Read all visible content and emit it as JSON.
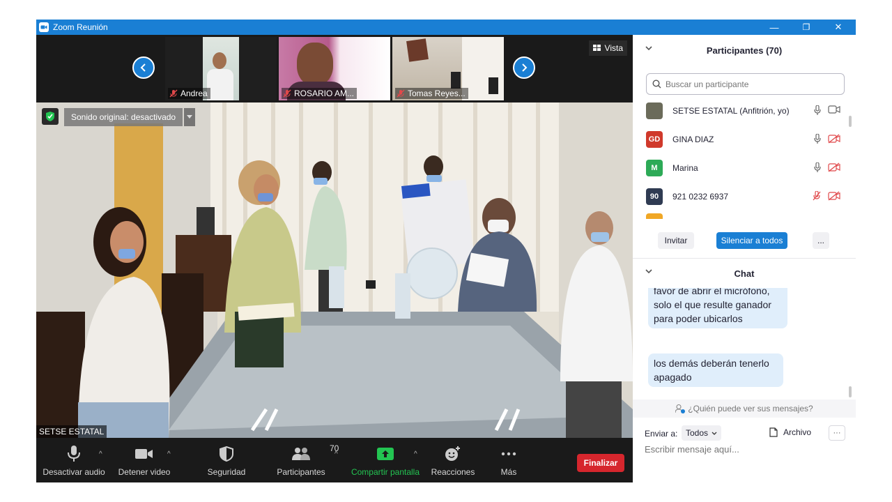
{
  "window": {
    "title": "Zoom Reunión",
    "controls": {
      "minimize": "—",
      "restore": "❐",
      "close": "✕"
    }
  },
  "video": {
    "view_label": "Vista",
    "thumbnails": [
      {
        "name": "Andrea",
        "muted": true
      },
      {
        "name": "ROSARIO AM...",
        "muted": true
      },
      {
        "name": "Tomas Reyes...",
        "muted": true
      }
    ],
    "sound_label": "Sonido original: desactivado",
    "speaker_name": "SETSE ESTATAL"
  },
  "toolbar": {
    "mute_audio": "Desactivar audio",
    "stop_video": "Detener video",
    "security": "Seguridad",
    "participants": "Participantes",
    "participants_count": "70",
    "share_screen": "Compartir pantalla",
    "reactions": "Reacciones",
    "more": "Más",
    "end": "Finalizar"
  },
  "participants_panel": {
    "title": "Participantes (70)",
    "search_placeholder": "Buscar un participante",
    "items": [
      {
        "initials": "",
        "name": "SETSE ESTATAL (Anfitrión, yo)",
        "avatar_color": "#6b6b5a",
        "mic_muted": false,
        "video_off": false
      },
      {
        "initials": "GD",
        "name": "GINA DIAZ",
        "avatar_color": "#d0392b",
        "mic_muted": false,
        "video_off": true
      },
      {
        "initials": "M",
        "name": "Marina",
        "avatar_color": "#2daa57",
        "mic_muted": false,
        "video_off": true
      },
      {
        "initials": "90",
        "name": "921 0232 6937",
        "avatar_color": "#2f3b52",
        "mic_muted": true,
        "video_off": true
      }
    ],
    "invite": "Invitar",
    "mute_all": "Silenciar a todos",
    "more": "..."
  },
  "chat_panel": {
    "title": "Chat",
    "messages": [
      "favor de abrir el micrófono,\nsolo el que resulte ganador\npara poder ubicarlos",
      "los demás deberán tenerlo\napagado"
    ],
    "who_sees": "¿Quién puede ver sus mensajes?",
    "send_to_label": "Enviar a:",
    "send_to_value": "Todos",
    "file_label": "Archivo",
    "more": "···",
    "input_placeholder": "Escribir mensaje aquí..."
  },
  "colors": {
    "accent": "#1a7fd4",
    "end_button": "#d6262d",
    "share_green": "#23c552",
    "muted_red": "#e0484a"
  }
}
